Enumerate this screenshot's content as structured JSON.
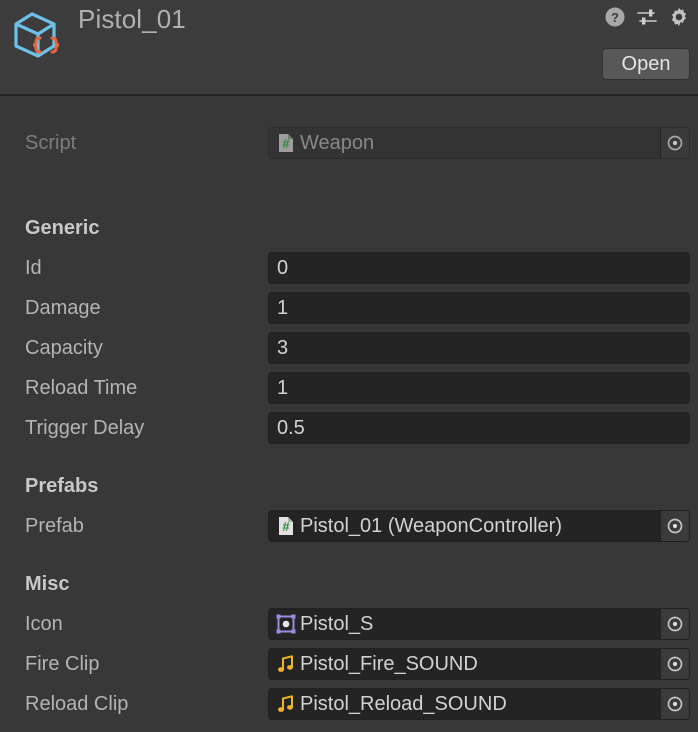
{
  "header": {
    "title": "Pistol_01",
    "asset_icon": "scriptableobject-cube-icon",
    "icons": [
      {
        "name": "help-icon",
        "label": "Help"
      },
      {
        "name": "preset-icon",
        "label": "Presets"
      },
      {
        "name": "gear-icon",
        "label": "Settings"
      }
    ],
    "open_label": "Open"
  },
  "script_row": {
    "label": "Script",
    "value": "Weapon",
    "icon": "csharp-script-icon",
    "disabled": true
  },
  "sections": [
    {
      "title": "Generic",
      "rows": [
        {
          "label": "Id",
          "value": "0",
          "type": "number"
        },
        {
          "label": "Damage",
          "value": "1",
          "type": "number"
        },
        {
          "label": "Capacity",
          "value": "3",
          "type": "number"
        },
        {
          "label": "Reload Time",
          "value": "1",
          "type": "number"
        },
        {
          "label": "Trigger Delay",
          "value": "0.5",
          "type": "number"
        }
      ]
    },
    {
      "title": "Prefabs",
      "rows": [
        {
          "label": "Prefab",
          "value": "Pistol_01 (WeaponController)",
          "type": "object",
          "icon": "csharp-script-icon"
        }
      ]
    },
    {
      "title": "Misc",
      "rows": [
        {
          "label": "Icon",
          "value": "Pistol_S",
          "type": "object",
          "icon": "sprite-icon"
        },
        {
          "label": "Fire Clip",
          "value": "Pistol_Fire_SOUND",
          "type": "object",
          "icon": "audioclip-icon"
        },
        {
          "label": "Reload Clip",
          "value": "Pistol_Reload_SOUND",
          "type": "object",
          "icon": "audioclip-icon"
        }
      ]
    }
  ],
  "colors": {
    "background": "#383838",
    "header_background": "#3c3c3c",
    "field_background": "#242424",
    "text": "#b4b4b4",
    "text_dim": "#7d7d7d",
    "cube_outline": "#6fc0e8",
    "braces": "#e8663c",
    "script_hash": "#2f8a3c",
    "sprite_outline": "#9a8ce0",
    "audio_note": "#f0b32a"
  }
}
